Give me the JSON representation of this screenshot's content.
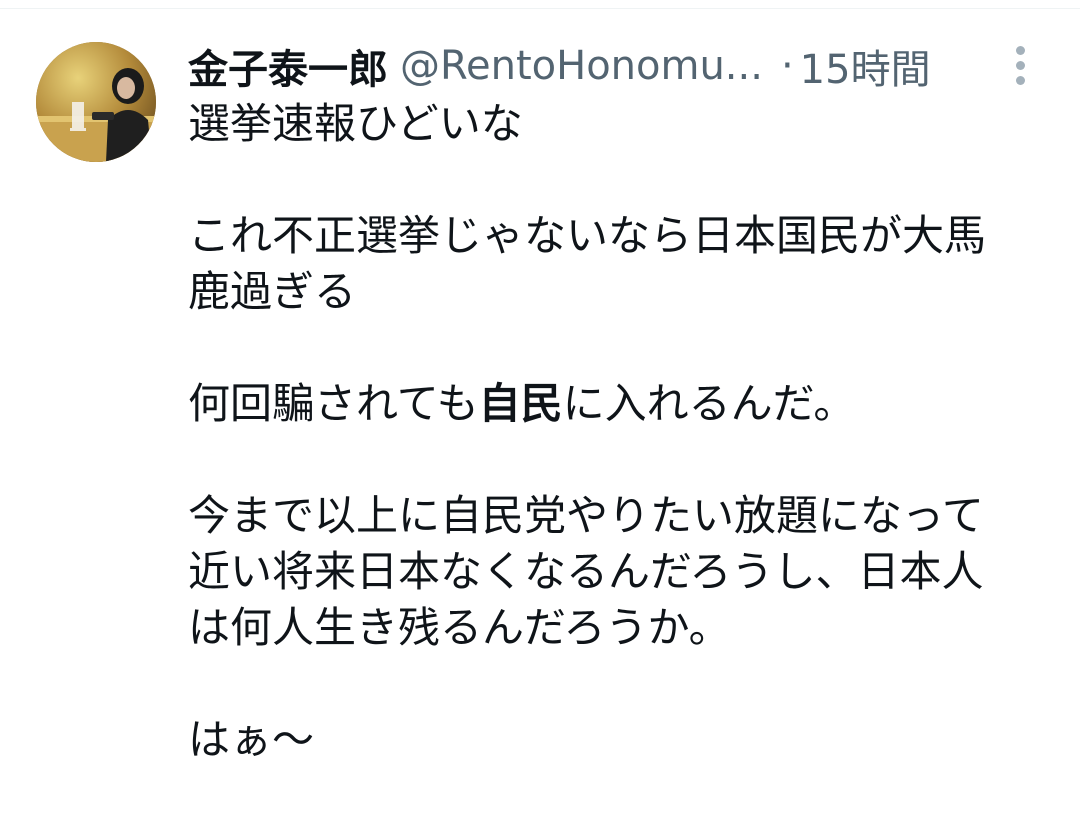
{
  "tweet": {
    "display_name": "金子泰一郎",
    "handle": "@RentoHonomu...",
    "separator": "·",
    "time": "15時間",
    "more_icon": "more-vertical-icon",
    "avatar_icon": "profile-photo",
    "paragraphs": [
      {
        "lines": [
          "選挙速報ひどいな"
        ]
      },
      {
        "lines": [
          "これ不正選挙じゃないなら日本国民が大馬",
          "鹿過ぎる"
        ]
      },
      {
        "line_parts": {
          "before": "何回騙されても",
          "bold": "自民",
          "after": "に入れるんだ。"
        }
      },
      {
        "lines": [
          "今まで以上に自民党やりたい放題になって",
          "近い将来日本なくなるんだろうし、日本人",
          "は何人生き残るんだろうか。"
        ]
      },
      {
        "lines": [
          "はぁ〜"
        ]
      }
    ]
  },
  "colors": {
    "text": "#0f1419",
    "secondary": "#536471",
    "divider": "#eff3f4"
  }
}
